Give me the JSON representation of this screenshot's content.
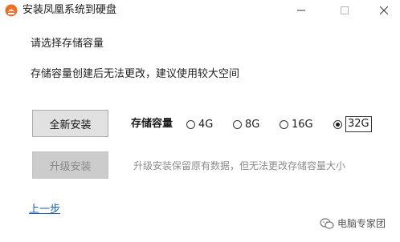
{
  "window": {
    "title": "安装凤凰系统到硬盘",
    "icons": {
      "app": "phoenix-logo-icon",
      "minimize": "minimize-icon",
      "maximize": "maximize-icon",
      "close": "close-icon"
    }
  },
  "content": {
    "choose_label": "请选择存储容量",
    "note": "存储容量创建后无法更改，建议使用较大空间",
    "new_install_label": "全新安装",
    "capacity_label": "存储容量",
    "capacity_options": [
      "4G",
      "8G",
      "16G",
      "32G"
    ],
    "selected_capacity": "32G",
    "upgrade_label": "升级安装",
    "upgrade_note": "升级安装保留原有数据，但无法更改存储容量大小",
    "back_link": "上一步"
  },
  "watermark": {
    "text": "电脑专家团",
    "icon": "wechat-icon"
  },
  "colors": {
    "link": "#1a5fb4",
    "disabled_text": "#8c8c8c",
    "button_bg": "#e1e1e1",
    "disabled_button_bg": "#cccccc"
  }
}
